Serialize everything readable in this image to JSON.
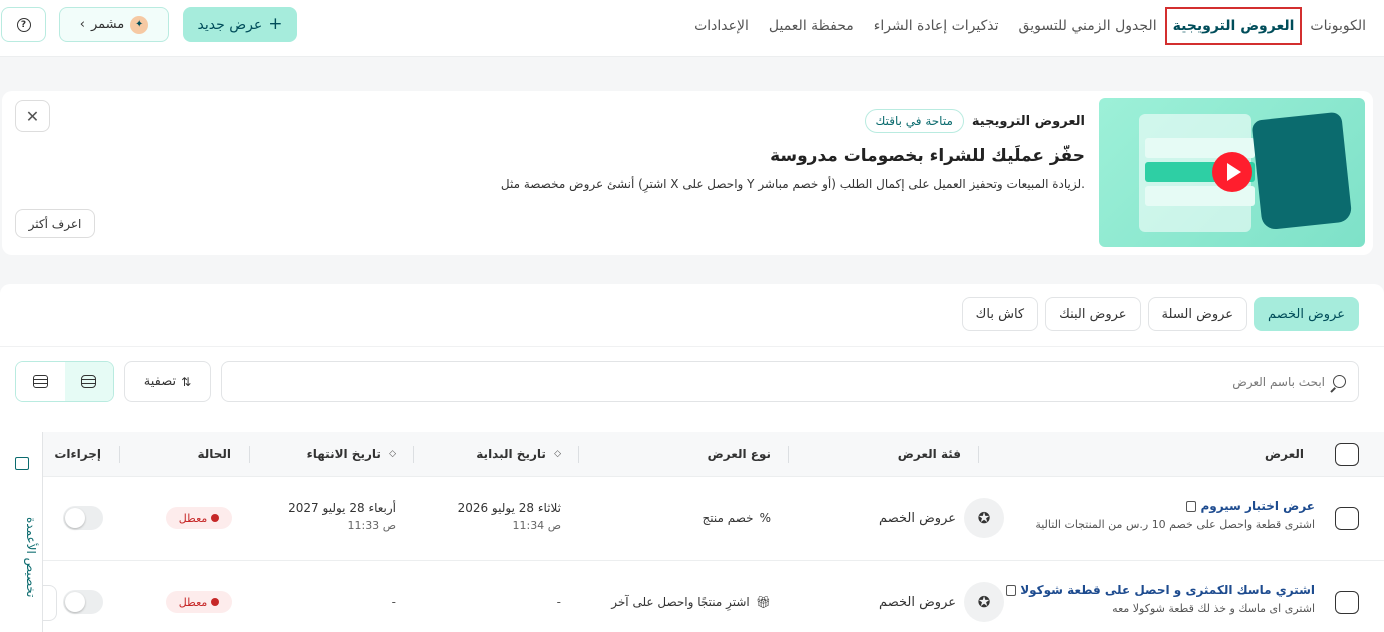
{
  "nav": {
    "items": [
      {
        "label": "الكوبونات",
        "active": false
      },
      {
        "label": "العروض الترويجية",
        "active": true
      },
      {
        "label": "الجدول الزمني للتسويق",
        "active": false
      },
      {
        "label": "تذكيرات إعادة الشراء",
        "active": false
      },
      {
        "label": "محفظة العميل",
        "active": false
      },
      {
        "label": "الإعدادات",
        "active": false
      }
    ]
  },
  "header": {
    "new_offer_label": "عرض جديد",
    "store_name": "مشمر"
  },
  "banner": {
    "label": "العروض الترويجية",
    "plan_badge": "متاحة في باقتك",
    "title": "حفّز عملَيك للشراء بخصومات مدروسة",
    "description": "أنشئ عروض مخصصة مثل (اشترِ X واحصل على Y أو خصم مباشر) لزيادة المبيعات وتحفيز العميل على إكمال الطلب.",
    "learn_more_label": "اعرف أكثر"
  },
  "tabs": [
    {
      "label": "عروض الخصم",
      "active": true
    },
    {
      "label": "عروض السلة",
      "active": false
    },
    {
      "label": "عروض البنك",
      "active": false
    },
    {
      "label": "كاش باك",
      "active": false
    }
  ],
  "search": {
    "placeholder": "ابحث باسم العرض"
  },
  "filter_label": "تصفية",
  "customize_columns_label": "تخصيص الأعمدة",
  "table": {
    "headers": {
      "offer": "العرض",
      "category": "فئة العرض",
      "type": "نوع العرض",
      "start": "تاريخ البداية",
      "end": "تاريخ الانتهاء",
      "status": "الحالة",
      "actions": "إجراءات"
    },
    "rows": [
      {
        "name": "عرض اختبار سيروم",
        "description": "اشترى قطعة واحصل على خصم 10 ر.س من المنتجات التالية",
        "category": "عروض الخصم",
        "type_icon": "%",
        "type": "خصم منتج",
        "start_date": "ثلاثاء 28 يوليو 2026",
        "start_time": "11:34 ص",
        "end_date": "أربعاء 28 يوليو 2027",
        "end_time": "11:33 ص",
        "status": "معطل"
      },
      {
        "name": "اشتري ماسك الكمثرى و احصل على قطعة شوكولا",
        "description": "اشترى اى ماسك و خذ لك قطعة شوكولا معه",
        "category": "عروض الخصم",
        "type_icon": "gift-icon",
        "type": "اشترِ منتجًا واحصل على آخر",
        "start_dash": "-",
        "end_dash": "-",
        "status": "معطل"
      }
    ]
  },
  "colors": {
    "accent": "#a6ecdc",
    "brand_dark": "#004d5a",
    "active_outline": "#d32f2f",
    "status_disabled": "#c62828",
    "link": "#1d4b8f"
  }
}
